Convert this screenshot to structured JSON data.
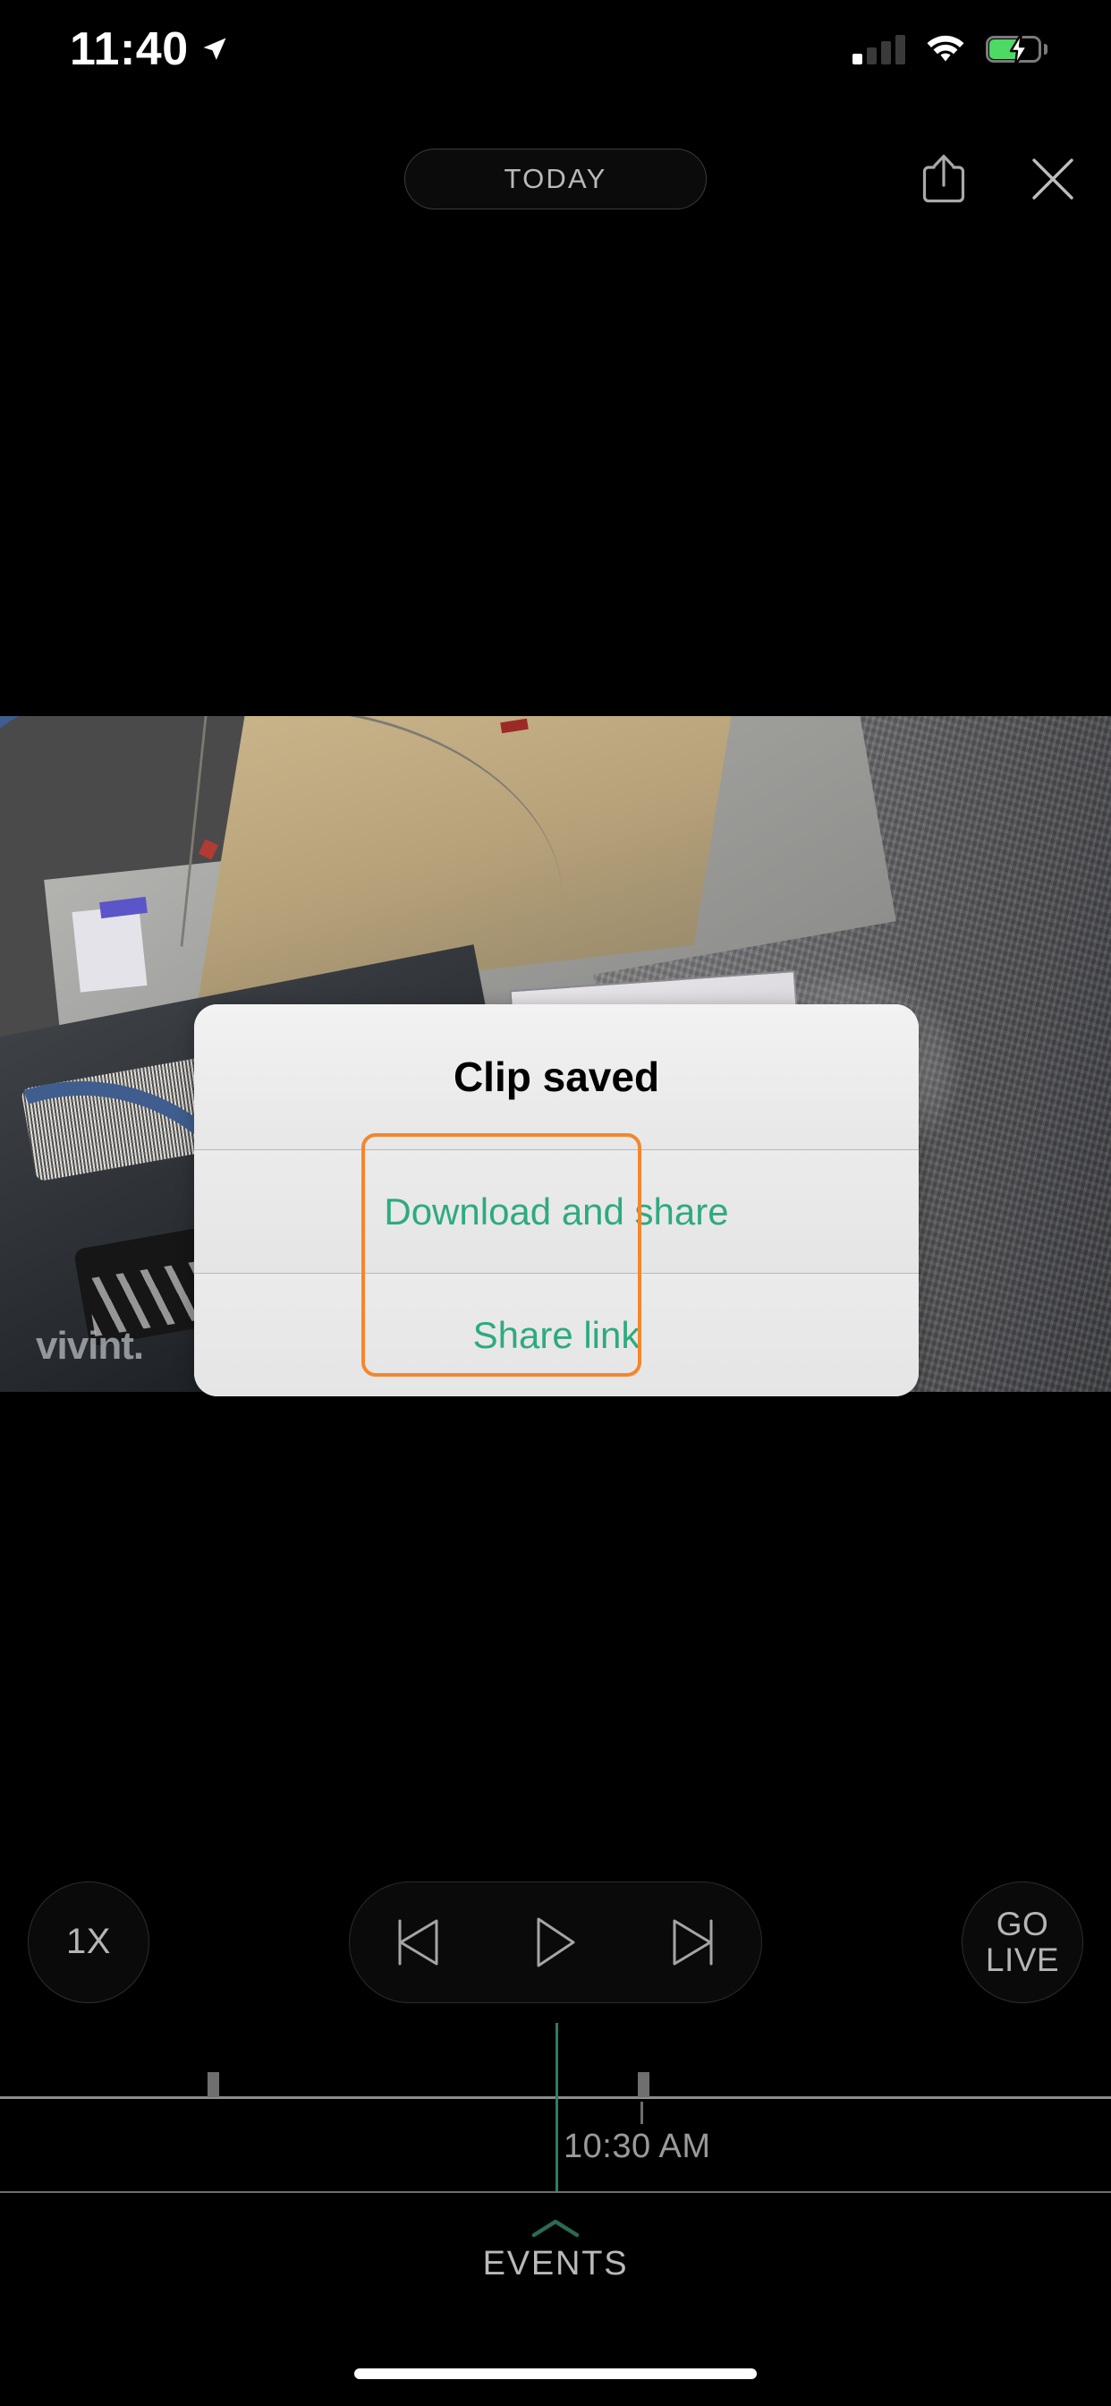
{
  "status_bar": {
    "time": "11:40",
    "location_icon": "location-arrow-icon",
    "cellular_icon": "cellular-signal-icon",
    "cellular_bars_filled": 1,
    "cellular_bars_total": 4,
    "wifi_icon": "wifi-icon",
    "battery_icon": "battery-charging-icon",
    "battery_charging": true
  },
  "nav": {
    "date_pill_label": "TODAY",
    "share_icon": "share-icon",
    "close_icon": "close-icon"
  },
  "video": {
    "watermark": "vivint."
  },
  "alert": {
    "title": "Clip saved",
    "options": [
      {
        "label": "Download and share"
      },
      {
        "label": "Share link"
      }
    ],
    "highlight_color": "#f5862e",
    "action_color": "#2eaa7f"
  },
  "controls": {
    "speed_label": "1X",
    "previous_icon": "skip-previous-icon",
    "play_icon": "play-icon",
    "next_icon": "skip-next-icon",
    "go_live_line1": "GO",
    "go_live_line2": "LIVE"
  },
  "timeline": {
    "current_time_label": "10:30 AM",
    "playhead_color": "#2f7d62",
    "markers": 2
  },
  "events": {
    "chevron_icon": "chevron-up-icon",
    "label": "EVENTS"
  },
  "system": {
    "home_indicator": "home-indicator"
  }
}
